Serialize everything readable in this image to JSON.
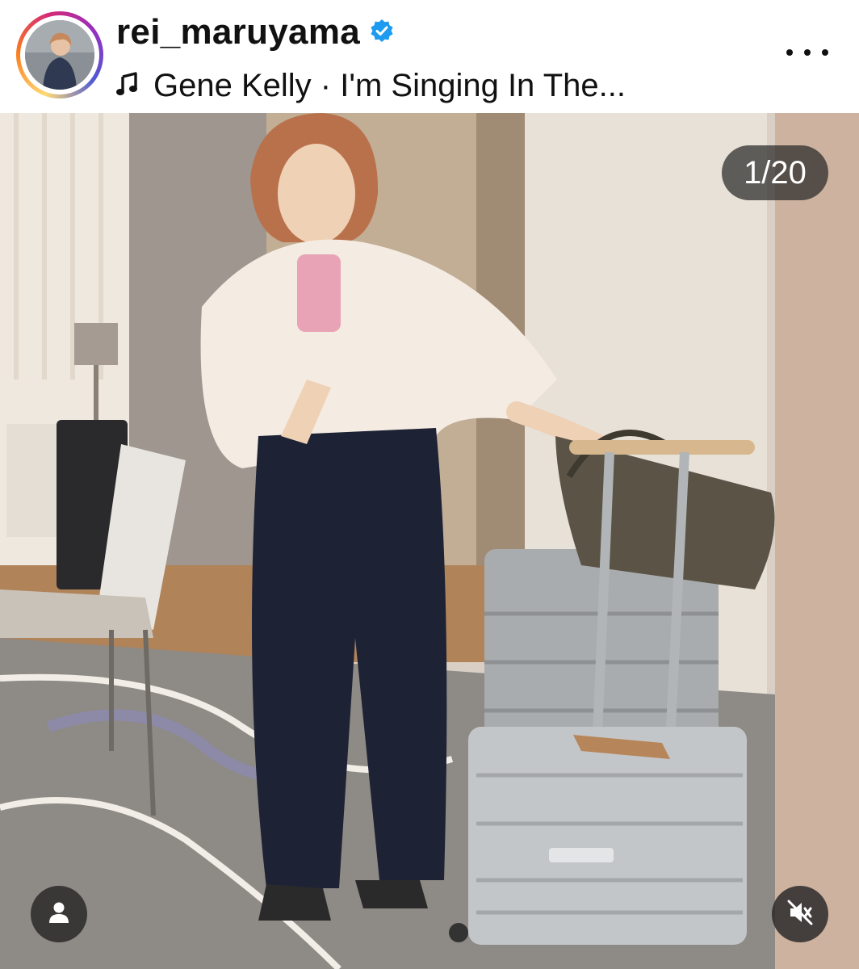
{
  "header": {
    "username": "rei_maruyama",
    "verified": true,
    "audio_icon": "music-note-icon",
    "audio_track": "Gene Kelly · I'm Singing In The...",
    "more_icon": "more-options-icon"
  },
  "media": {
    "counter": "1/20",
    "tag_icon": "user-tag-icon",
    "audio_toggle_icon": "speaker-muted-icon"
  },
  "colors": {
    "verified_badge": "#1d9bf0",
    "overlay": "#262626"
  }
}
